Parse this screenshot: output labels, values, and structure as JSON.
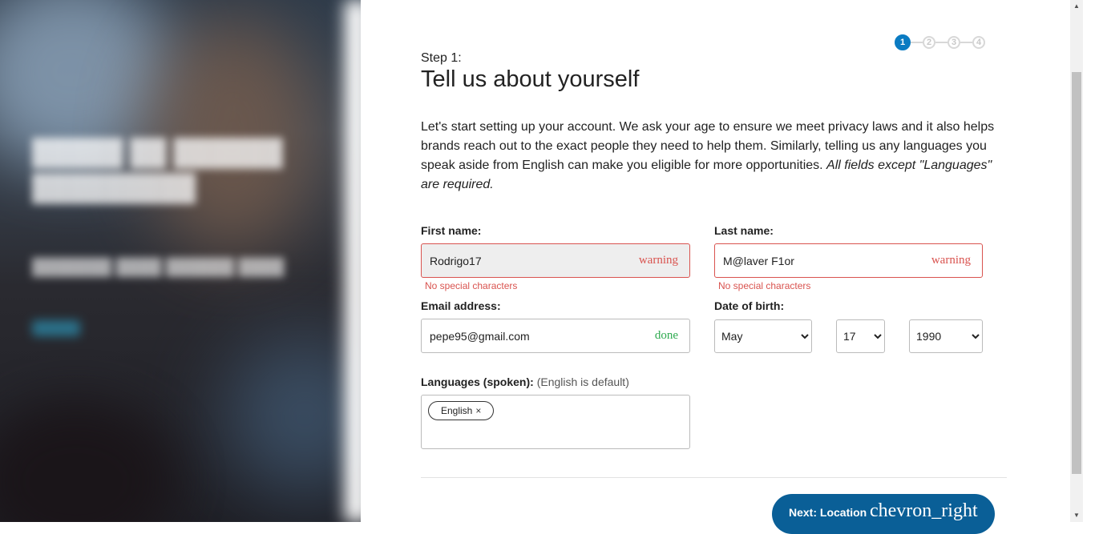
{
  "stepper": {
    "steps": [
      "1",
      "2",
      "3",
      "4"
    ],
    "active_index": 0
  },
  "header": {
    "step_label": "Step 1:",
    "title": "Tell us about yourself"
  },
  "intro": {
    "text": "Let's start setting up your account. We ask your age to ensure we meet privacy laws and it also helps brands reach out to the exact people they need to help them. Similarly, telling us any languages you speak aside from English can make you eligible for more opportunities. ",
    "emphasis": "All fields except \"Languages\" are required."
  },
  "form": {
    "first_name": {
      "label": "First name:",
      "value": "Rodrigo17",
      "status": "warning",
      "error": "No special characters"
    },
    "last_name": {
      "label": "Last name:",
      "value": "M@laver F1or",
      "status": "warning",
      "error": "No special characters"
    },
    "email": {
      "label": "Email address:",
      "value": "pepe95@gmail.com",
      "status": "done"
    },
    "dob": {
      "label": "Date of birth:",
      "month": "May",
      "day": "17",
      "year": "1990"
    },
    "languages": {
      "label": "Languages (spoken):",
      "hint": "(English is default)",
      "chips": [
        {
          "label": "English",
          "remove": "×"
        }
      ]
    }
  },
  "next_button": {
    "label": "Next: Location",
    "icon": "chevron_right"
  },
  "colors": {
    "accent": "#0a7bc2",
    "button": "#0a5f97",
    "error": "#d9534f",
    "success": "#2eaa4f"
  }
}
